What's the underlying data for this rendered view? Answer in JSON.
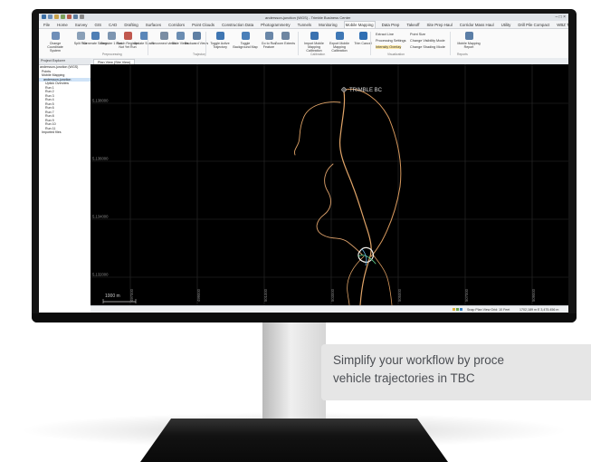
{
  "app": {
    "title": "andersson-junction (WGS) - Trimble Business Center",
    "tabs": [
      "File",
      "Home",
      "Survey",
      "GIS",
      "CAD",
      "Drafting",
      "Surfaces",
      "Corridors",
      "Point Clouds",
      "Construction Data",
      "Photogrammetry",
      "Tunnels",
      "Monitoring",
      "Mobile Mapping",
      "Data Prep",
      "Takeoff",
      "Site Prep Haul",
      "Corridor Mass Haul",
      "Utility",
      "Drill Pile Compact",
      "WBZ Toolbox",
      "Marine",
      "Support"
    ],
    "active_tab": "Mobile Mapping"
  },
  "ribbon": {
    "buttons": [
      {
        "name": "change-coordinate-system",
        "label": "Change Coordinate System",
        "color": "#6f8fb8"
      },
      {
        "name": "split-run",
        "label": "Split Run",
        "color": "#8aa0b8"
      },
      {
        "name": "generate-scans",
        "label": "Generate Scans",
        "color": "#4f7fb5"
      },
      {
        "name": "register-1-run",
        "label": "Register 1 Run",
        "color": "#7d95b0"
      },
      {
        "name": "batch-register",
        "label": "Batch Register Not Yet Run",
        "color": "#c0584e"
      },
      {
        "name": "update-scans",
        "label": "Update Scans",
        "color": "#5a86b8"
      },
      {
        "name": "reconnect-views",
        "label": "Reconnect views",
        "color": "#7a8da3"
      },
      {
        "name": "slide-views",
        "label": "Slide Views",
        "color": "#6b8db2"
      },
      {
        "name": "backward-views",
        "label": "Backward Views",
        "color": "#5f7fa3"
      },
      {
        "name": "toggle-active-trajectory",
        "label": "Toggle Active Trajectory",
        "color": "#3f76b2"
      },
      {
        "name": "toggle-background-map",
        "label": "Toggle Background Map",
        "color": "#4a7fb8"
      },
      {
        "name": "go-to-run-feature",
        "label": "Go to Run Feature",
        "color": "#6a87a8"
      },
      {
        "name": "zoom-extents",
        "label": "Zoom Extents",
        "color": "#6f86a1"
      },
      {
        "name": "import-mobile-mapping",
        "label": "Import Mobile Mapping Calibration",
        "color": "#3a72b0"
      },
      {
        "name": "export-mobile-mapping",
        "label": "Export Mobile Mapping Calibration",
        "color": "#3f78b5"
      },
      {
        "name": "trim-cancel",
        "label": "Trim Cancel",
        "color": "#2f6fb3"
      }
    ],
    "small_items": [
      "Extract Line",
      "Point Size",
      "Processing Settings",
      "Change Visibility Mode",
      "Intensity Overlay",
      "Change Shading Mode"
    ],
    "right_button": {
      "label": "Mobile Mapping Report",
      "color": "#5b7ea6"
    },
    "group_labels": [
      "Preprocessing",
      "Trajectory",
      "Calibration",
      "Visualization",
      "Reports"
    ]
  },
  "project_explorer": {
    "title": "Project Explorer",
    "items": [
      "andersson-junction (WGS)",
      "Points",
      "Mobile Mapping",
      "andersson-junction",
      "Uptick Overview",
      "Run 1",
      "Run 2",
      "Run 3",
      "Run 4",
      "Run 5",
      "Run 6",
      "Run 7",
      "Run 8",
      "Run 9",
      "Run 10",
      "Run 11",
      "Imported files"
    ],
    "selected_index": 3
  },
  "view": {
    "tab": "Plan View (Site View)",
    "site_label": "TRIMBLE BC",
    "scale_label": "1000 m",
    "grid_labels_y": [
      "5,138000",
      "5,136000",
      "5,134000",
      "5,132000"
    ],
    "grid_labels_x": [
      "497000",
      "499000",
      "501000",
      "503000",
      "505000",
      "507000",
      "509000"
    ]
  },
  "statusbar": {
    "text": "Snap  Plan View  Grid: 10 Feet",
    "coords": "1702,189 m  E  3,475.456 m"
  },
  "caption": {
    "text": "Simplify your workflow by proce\nvehicle trajectories in TBC"
  },
  "colors": {
    "bezel": "#141414",
    "trajectory": "#e0a468",
    "trajectory_highlight": "#f2efe9",
    "caption_bg": "#e6e6e6",
    "accent": "#2f78c4"
  }
}
